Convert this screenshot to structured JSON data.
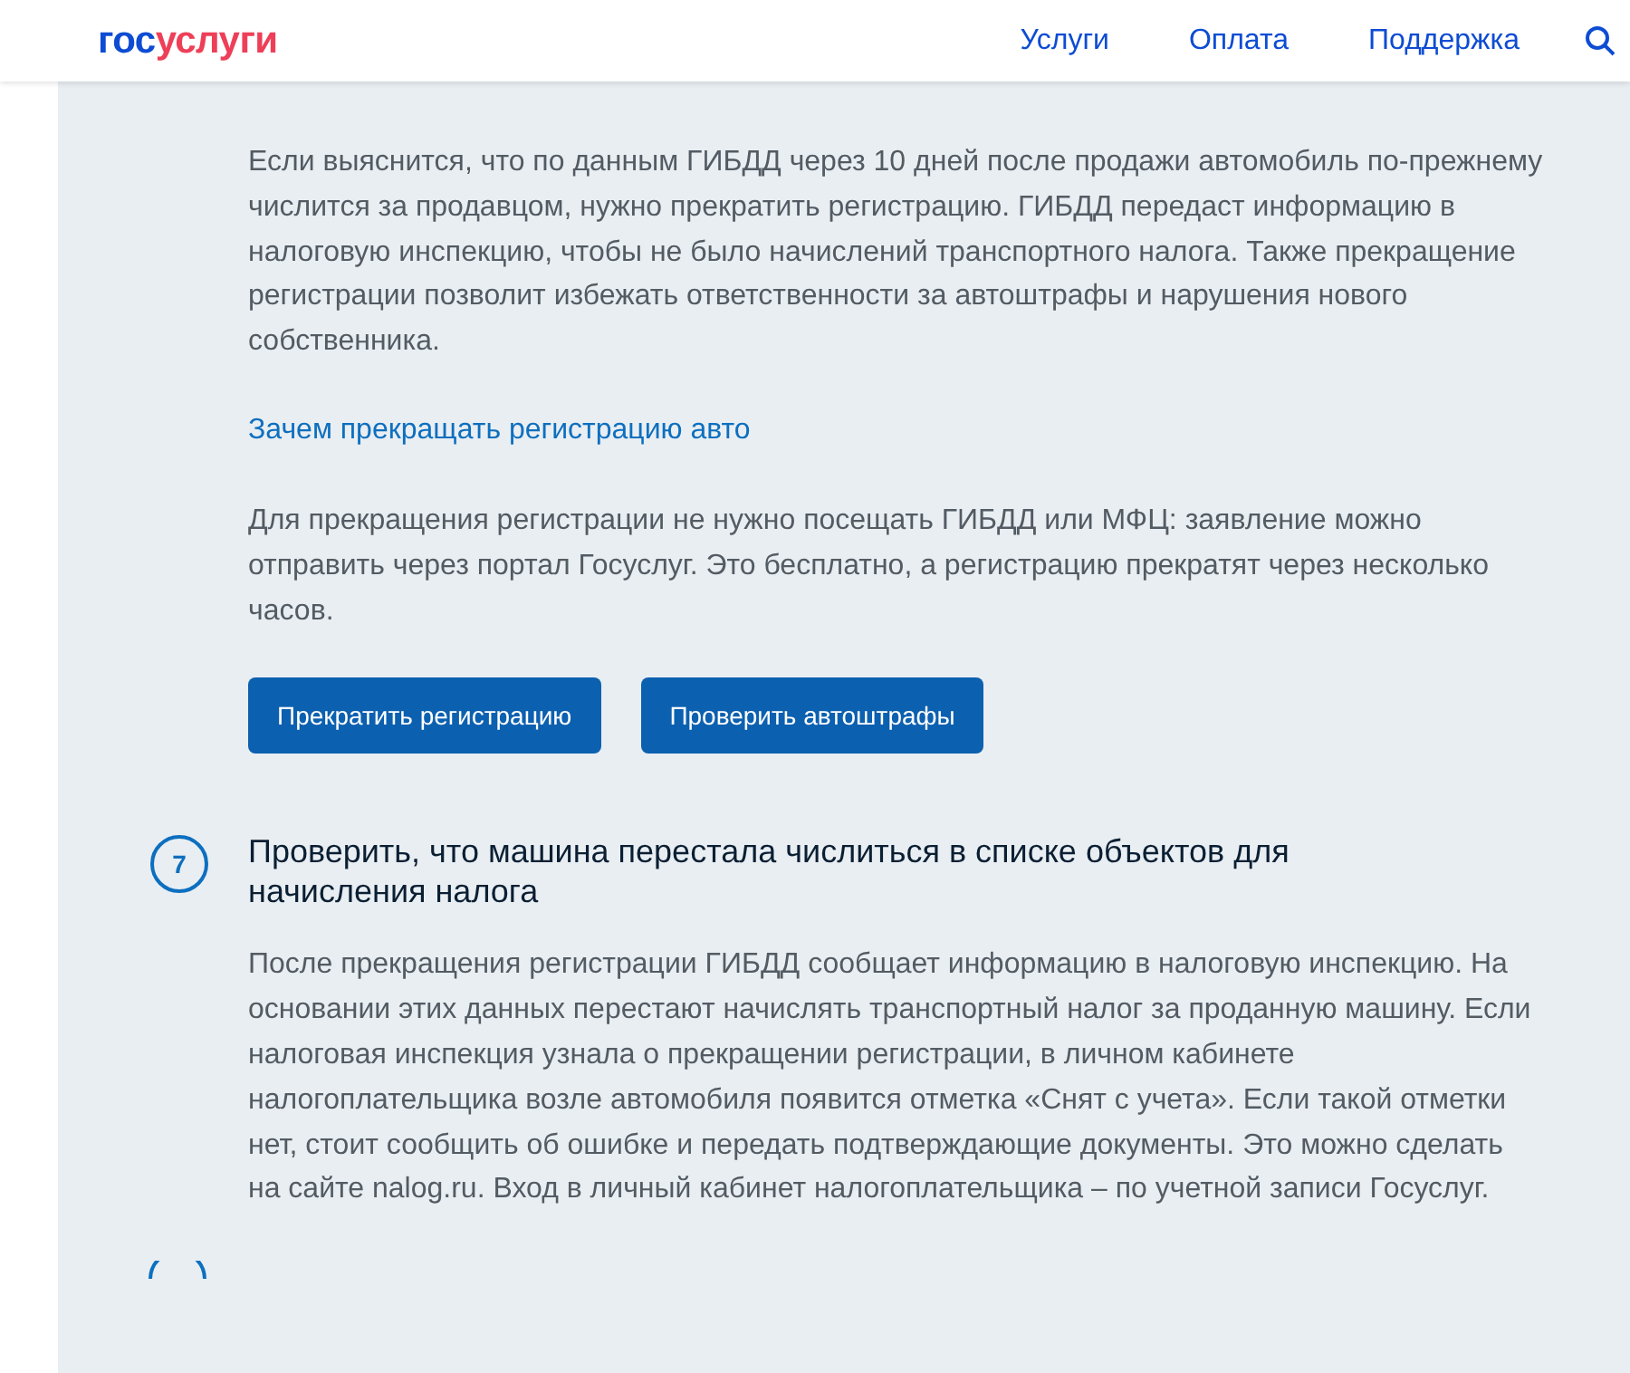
{
  "header": {
    "logo": {
      "first": "гос",
      "second": "услуги"
    },
    "nav": [
      "Услуги",
      "Оплата",
      "Поддержка"
    ]
  },
  "content": {
    "paragraphs_top": [
      "Если выяснится, что по данным ГИБДД через 10 дней после продажи автомобиль по-прежнему числится за продавцом, нужно прекратить регистрацию. ГИБДД передаст информацию в налоговую инспекцию, чтобы не было начислений транспортного налога. Также прекращение регистрации позволит избежать ответственности за автоштрафы и нарушения нового собственника."
    ],
    "link": "Зачем прекращать регистрацию авто",
    "paragraph_after_link": "Для прекращения регистрации не нужно посещать ГИБДД или МФЦ: заявление можно отправить через портал Госуслуг. Это бесплатно, а регистрацию прекратят через несколько часов.",
    "buttons": [
      "Прекратить регистрацию",
      "Проверить автоштрафы"
    ],
    "step": {
      "number": "7",
      "title": "Проверить, что машина перестала числиться в списке объектов для начисления налога",
      "text": "После прекращения регистрации ГИБДД сообщает информацию в налоговую инспекцию. На основании этих данных перестают начислять транспортный налог за проданную машину. Если налоговая инспекция узнала о прекращении регистрации, в личном кабинете налогоплательщика возле автомобиля появится отметка «Снят с учета». Если такой отметки нет, стоит сообщить об ошибке и передать подтверждающие документы. Это можно сделать на сайте nalog.ru. Вход в личный кабинет налогоплательщика – по учетной записи Госуслуг."
    }
  }
}
